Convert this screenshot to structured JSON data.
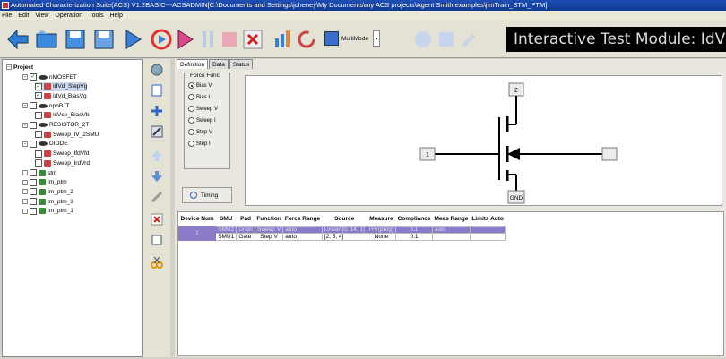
{
  "titlebar": {
    "text": "Automated Characterization Suite(ACS) V1.2BASIC---ACSADMIN[C:\\Documents and Settings\\jcheney\\My Documents\\my ACS projects\\Agent Smith examples\\jimTrain_STM_PTM]"
  },
  "menu": [
    "File",
    "Edit",
    "View",
    "Operation",
    "Tools",
    "Help"
  ],
  "toolbar": {
    "multimode_label": "MultiMode",
    "module_title": "Interactive Test Module: IdVd_StepVg"
  },
  "tree": {
    "root": "Project",
    "items": [
      {
        "label": "nMOSFET",
        "indent": 1,
        "icon": "device",
        "checked": true
      },
      {
        "label": "IdVd_StepVg",
        "indent": 2,
        "icon": "test",
        "checked": true,
        "selected": true
      },
      {
        "label": "IdVd_BiasVg",
        "indent": 2,
        "icon": "test",
        "checked": true
      },
      {
        "label": "npnBJT",
        "indent": 1,
        "icon": "device",
        "checked": false
      },
      {
        "label": "IcVce_BiasVb",
        "indent": 2,
        "icon": "test",
        "checked": false
      },
      {
        "label": "RESISTOR_2T",
        "indent": 1,
        "icon": "device",
        "checked": false
      },
      {
        "label": "Sweep_IV_2SMU",
        "indent": 2,
        "icon": "test",
        "checked": false
      },
      {
        "label": "DIODE",
        "indent": 1,
        "icon": "device",
        "checked": false
      },
      {
        "label": "Sweep_IfdVfd",
        "indent": 2,
        "icon": "test",
        "checked": false
      },
      {
        "label": "Sweep_IrdVrd",
        "indent": 2,
        "icon": "test",
        "checked": false
      },
      {
        "label": "stm",
        "indent": 1,
        "icon": "green",
        "checked": false
      },
      {
        "label": "tm_ptm",
        "indent": 1,
        "icon": "green",
        "checked": false
      },
      {
        "label": "tm_ptm_2",
        "indent": 1,
        "icon": "green",
        "checked": false
      },
      {
        "label": "tm_ptm_3",
        "indent": 1,
        "icon": "green",
        "checked": false
      },
      {
        "label": "tm_ptm_1",
        "indent": 1,
        "icon": "green",
        "checked": false
      }
    ]
  },
  "tabs": [
    "Definition",
    "Data",
    "Status"
  ],
  "force_func": {
    "title": "Force Func",
    "options": [
      "Bias V",
      "Bias I",
      "Sweep V",
      "Sweep I",
      "Step V",
      "Step I"
    ],
    "selected": 0
  },
  "timing_label": "Timing",
  "schematic": {
    "pin_drain": "2",
    "pin_gate": "1",
    "pin_source": "GND"
  },
  "table": {
    "headers": [
      "Device Num",
      "SMU",
      "Pad",
      "Function",
      "Force Range",
      "Source",
      "Measure",
      "Compliance",
      "Meas Range",
      "Limits Auto"
    ],
    "device_num": "1",
    "rows": [
      [
        "SMU2",
        "Drain",
        "Sweep V",
        "auto",
        "Linear [0, 14, 1]",
        "I+V(prog)",
        "0.1",
        "auto",
        ""
      ],
      [
        "SMU1",
        "Gate",
        "Step V",
        "auto",
        "[2, 5, 4]",
        "None",
        "0.1",
        "",
        ""
      ]
    ]
  },
  "colors": {
    "title_bar": "#1f4fb4",
    "row_highlight": "#8a7ac7",
    "banner_bg": "#000000"
  }
}
